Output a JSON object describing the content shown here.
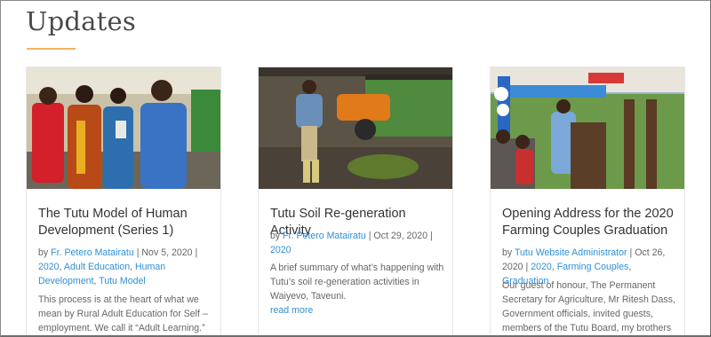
{
  "section": {
    "title": "Updates"
  },
  "posts": [
    {
      "title": "The Tutu Model of Human Development (Series 1)",
      "by": "by ",
      "author": "Fr. Petero Matairatu",
      "date": "Nov 5, 2020",
      "categories": [
        "2020",
        "Adult Education",
        "Human Development",
        "Tutu Model"
      ],
      "excerpt": "This process is at the heart of what we mean by Rural Adult Education for Self – employment. We call it “Adult Learning.”",
      "read_more": ""
    },
    {
      "title": "Tutu Soil Re-generation Activity",
      "by": "by ",
      "author": "Fr. Petero Matairatu",
      "date": "Oct 29, 2020",
      "categories": [
        "2020"
      ],
      "excerpt": "A brief summary of what’s happening with Tutu’s soil re-generation activities in Waiyevo, Taveuni.",
      "read_more": "read more"
    },
    {
      "title": "Opening Address for the 2020 Farming Couples Graduation",
      "by": "by ",
      "author": "Tutu Website Administrator",
      "date": "Oct 26, 2020",
      "categories": [
        "2020",
        "Farming Couples",
        "Graduation"
      ],
      "excerpt": "Our guest of honour, The Permanent Secretary for Agriculture, Mr Ritesh Dass, Government officials, invited guests, members of the Tutu Board, my brothers",
      "read_more": ""
    }
  ]
}
